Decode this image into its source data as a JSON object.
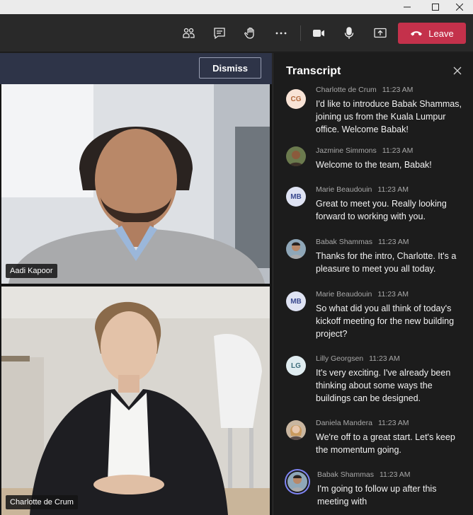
{
  "window": {
    "controls": [
      "minimize-icon",
      "maximize-icon",
      "close-icon"
    ]
  },
  "toolbar": {
    "icons": [
      "people-icon",
      "chat-icon",
      "raise-hand-icon",
      "more-icon",
      "camera-icon",
      "microphone-icon",
      "share-screen-icon"
    ],
    "leave_label": "Leave",
    "leave_color": "#c4314b"
  },
  "stage": {
    "dismiss_label": "Dismiss",
    "participants": [
      {
        "name": "Aadi Kapoor"
      },
      {
        "name": "Charlotte de Crum"
      }
    ]
  },
  "transcript": {
    "title": "Transcript",
    "messages": [
      {
        "avatar": "CG",
        "name": "Charlotte de Crum",
        "time": "11:23 AM",
        "text": "I'd like to introduce Babak Shammas, joining us from the Kuala Lumpur office. Welcome Babak!"
      },
      {
        "avatar": "photo",
        "name": "Jazmine Simmons",
        "time": "11:23 AM",
        "text": "Welcome to the team, Babak!"
      },
      {
        "avatar": "MB",
        "name": "Marie Beaudouin",
        "time": "11:23 AM",
        "text": "Great to meet you. Really looking forward to working with you."
      },
      {
        "avatar": "photo",
        "name": "Babak Shammas",
        "time": "11:23 AM",
        "text": "Thanks for the intro, Charlotte. It's a pleasure to meet you all today."
      },
      {
        "avatar": "MB",
        "name": "Marie Beaudouin",
        "time": "11:23 AM",
        "text": "So what did you all think of today's kickoff meeting for the new building project?"
      },
      {
        "avatar": "LG",
        "name": "Lilly Georgsen",
        "time": "11:23 AM",
        "text": "It's very exciting. I've already been thinking about some ways the buildings can be designed."
      },
      {
        "avatar": "photo",
        "name": "Daniela Mandera",
        "time": "11:23 AM",
        "text": "We're off to a great start. Let's keep the momentum going."
      },
      {
        "avatar": "photo",
        "name": "Babak Shammas",
        "time": "11:23 AM",
        "text": "I'm going to follow up after this meeting with"
      }
    ]
  }
}
